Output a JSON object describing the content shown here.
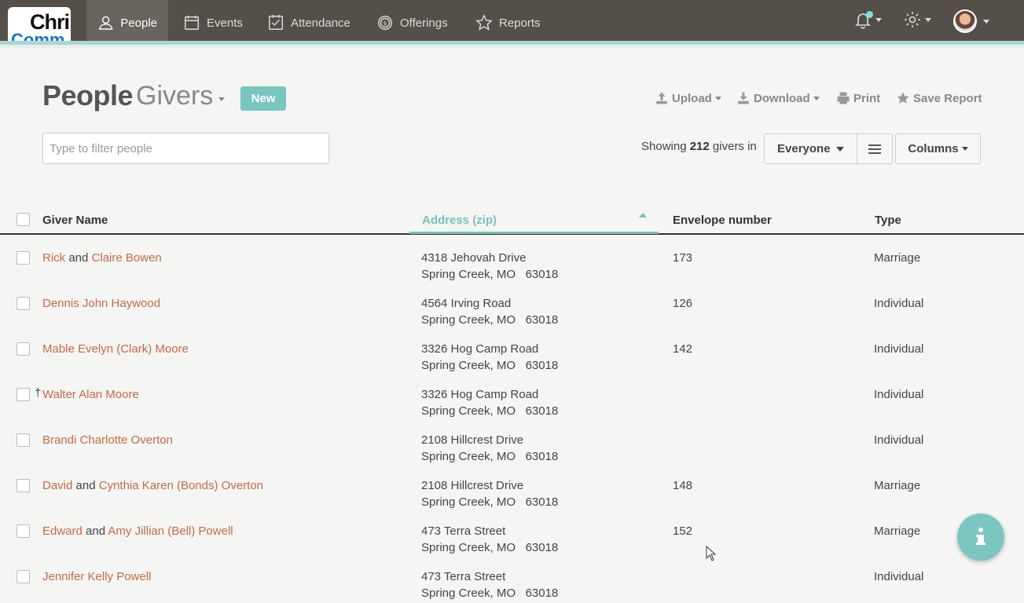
{
  "logo": {
    "line1": "Chri",
    "line2": "Comm"
  },
  "nav": {
    "items": [
      {
        "label": "People",
        "icon": "person-icon",
        "active": true
      },
      {
        "label": "Events",
        "icon": "calendar-icon",
        "active": false
      },
      {
        "label": "Attendance",
        "icon": "checklist-icon",
        "active": false
      },
      {
        "label": "Offerings",
        "icon": "coin-icon",
        "active": false
      },
      {
        "label": "Reports",
        "icon": "star-icon",
        "active": false
      }
    ]
  },
  "header": {
    "title": "People",
    "subtitle": "Givers",
    "new_label": "New",
    "upload": "Upload",
    "download": "Download",
    "print": "Print",
    "save_report": "Save Report"
  },
  "filter": {
    "placeholder": "Type to filter people"
  },
  "summary": {
    "prefix": "Showing",
    "count": "212",
    "suffix": "givers in"
  },
  "group_select": {
    "value": "Everyone"
  },
  "columns_label": "Columns",
  "table": {
    "headers": {
      "name": "Giver Name",
      "address": "Address (zip)",
      "envelope": "Envelope number",
      "type": "Type"
    },
    "rows": [
      {
        "names": [
          "Rick",
          "Claire Bowen"
        ],
        "joiner": "and",
        "dagger": "",
        "street": "4318 Jehovah Drive",
        "city": "Spring Creek, MO",
        "zip": "63018",
        "envelope": "173",
        "type": "Marriage"
      },
      {
        "names": [
          "Dennis John Haywood"
        ],
        "joiner": "",
        "dagger": "",
        "street": "4564 Irving Road",
        "city": "Spring Creek, MO",
        "zip": "63018",
        "envelope": "126",
        "type": "Individual"
      },
      {
        "names": [
          "Mable Evelyn (Clark) Moore"
        ],
        "joiner": "",
        "dagger": "",
        "street": "3326 Hog Camp Road",
        "city": "Spring Creek, MO",
        "zip": "63018",
        "envelope": "142",
        "type": "Individual"
      },
      {
        "names": [
          "Walter Alan Moore"
        ],
        "joiner": "",
        "dagger": "†",
        "street": "3326 Hog Camp Road",
        "city": "Spring Creek, MO",
        "zip": "63018",
        "envelope": "",
        "type": "Individual"
      },
      {
        "names": [
          "Brandi Charlotte Overton"
        ],
        "joiner": "",
        "dagger": "",
        "street": "2108 Hillcrest Drive",
        "city": "Spring Creek, MO",
        "zip": "63018",
        "envelope": "",
        "type": "Individual"
      },
      {
        "names": [
          "David",
          "Cynthia Karen (Bonds) Overton"
        ],
        "joiner": "and",
        "dagger": "",
        "street": "2108 Hillcrest Drive",
        "city": "Spring Creek, MO",
        "zip": "63018",
        "envelope": "148",
        "type": "Marriage"
      },
      {
        "names": [
          "Edward",
          "Amy Jillian (Bell) Powell"
        ],
        "joiner": "and",
        "dagger": "",
        "street": "473 Terra Street",
        "city": "Spring Creek, MO",
        "zip": "63018",
        "envelope": "152",
        "type": "Marriage"
      },
      {
        "names": [
          "Jennifer Kelly Powell"
        ],
        "joiner": "",
        "dagger": "",
        "street": "473 Terra Street",
        "city": "Spring Creek, MO",
        "zip": "63018",
        "envelope": "",
        "type": "Individual"
      }
    ]
  },
  "colors": {
    "accent": "#78c6c0",
    "name_link": "#c8683f",
    "nav_bg": "#545049"
  }
}
